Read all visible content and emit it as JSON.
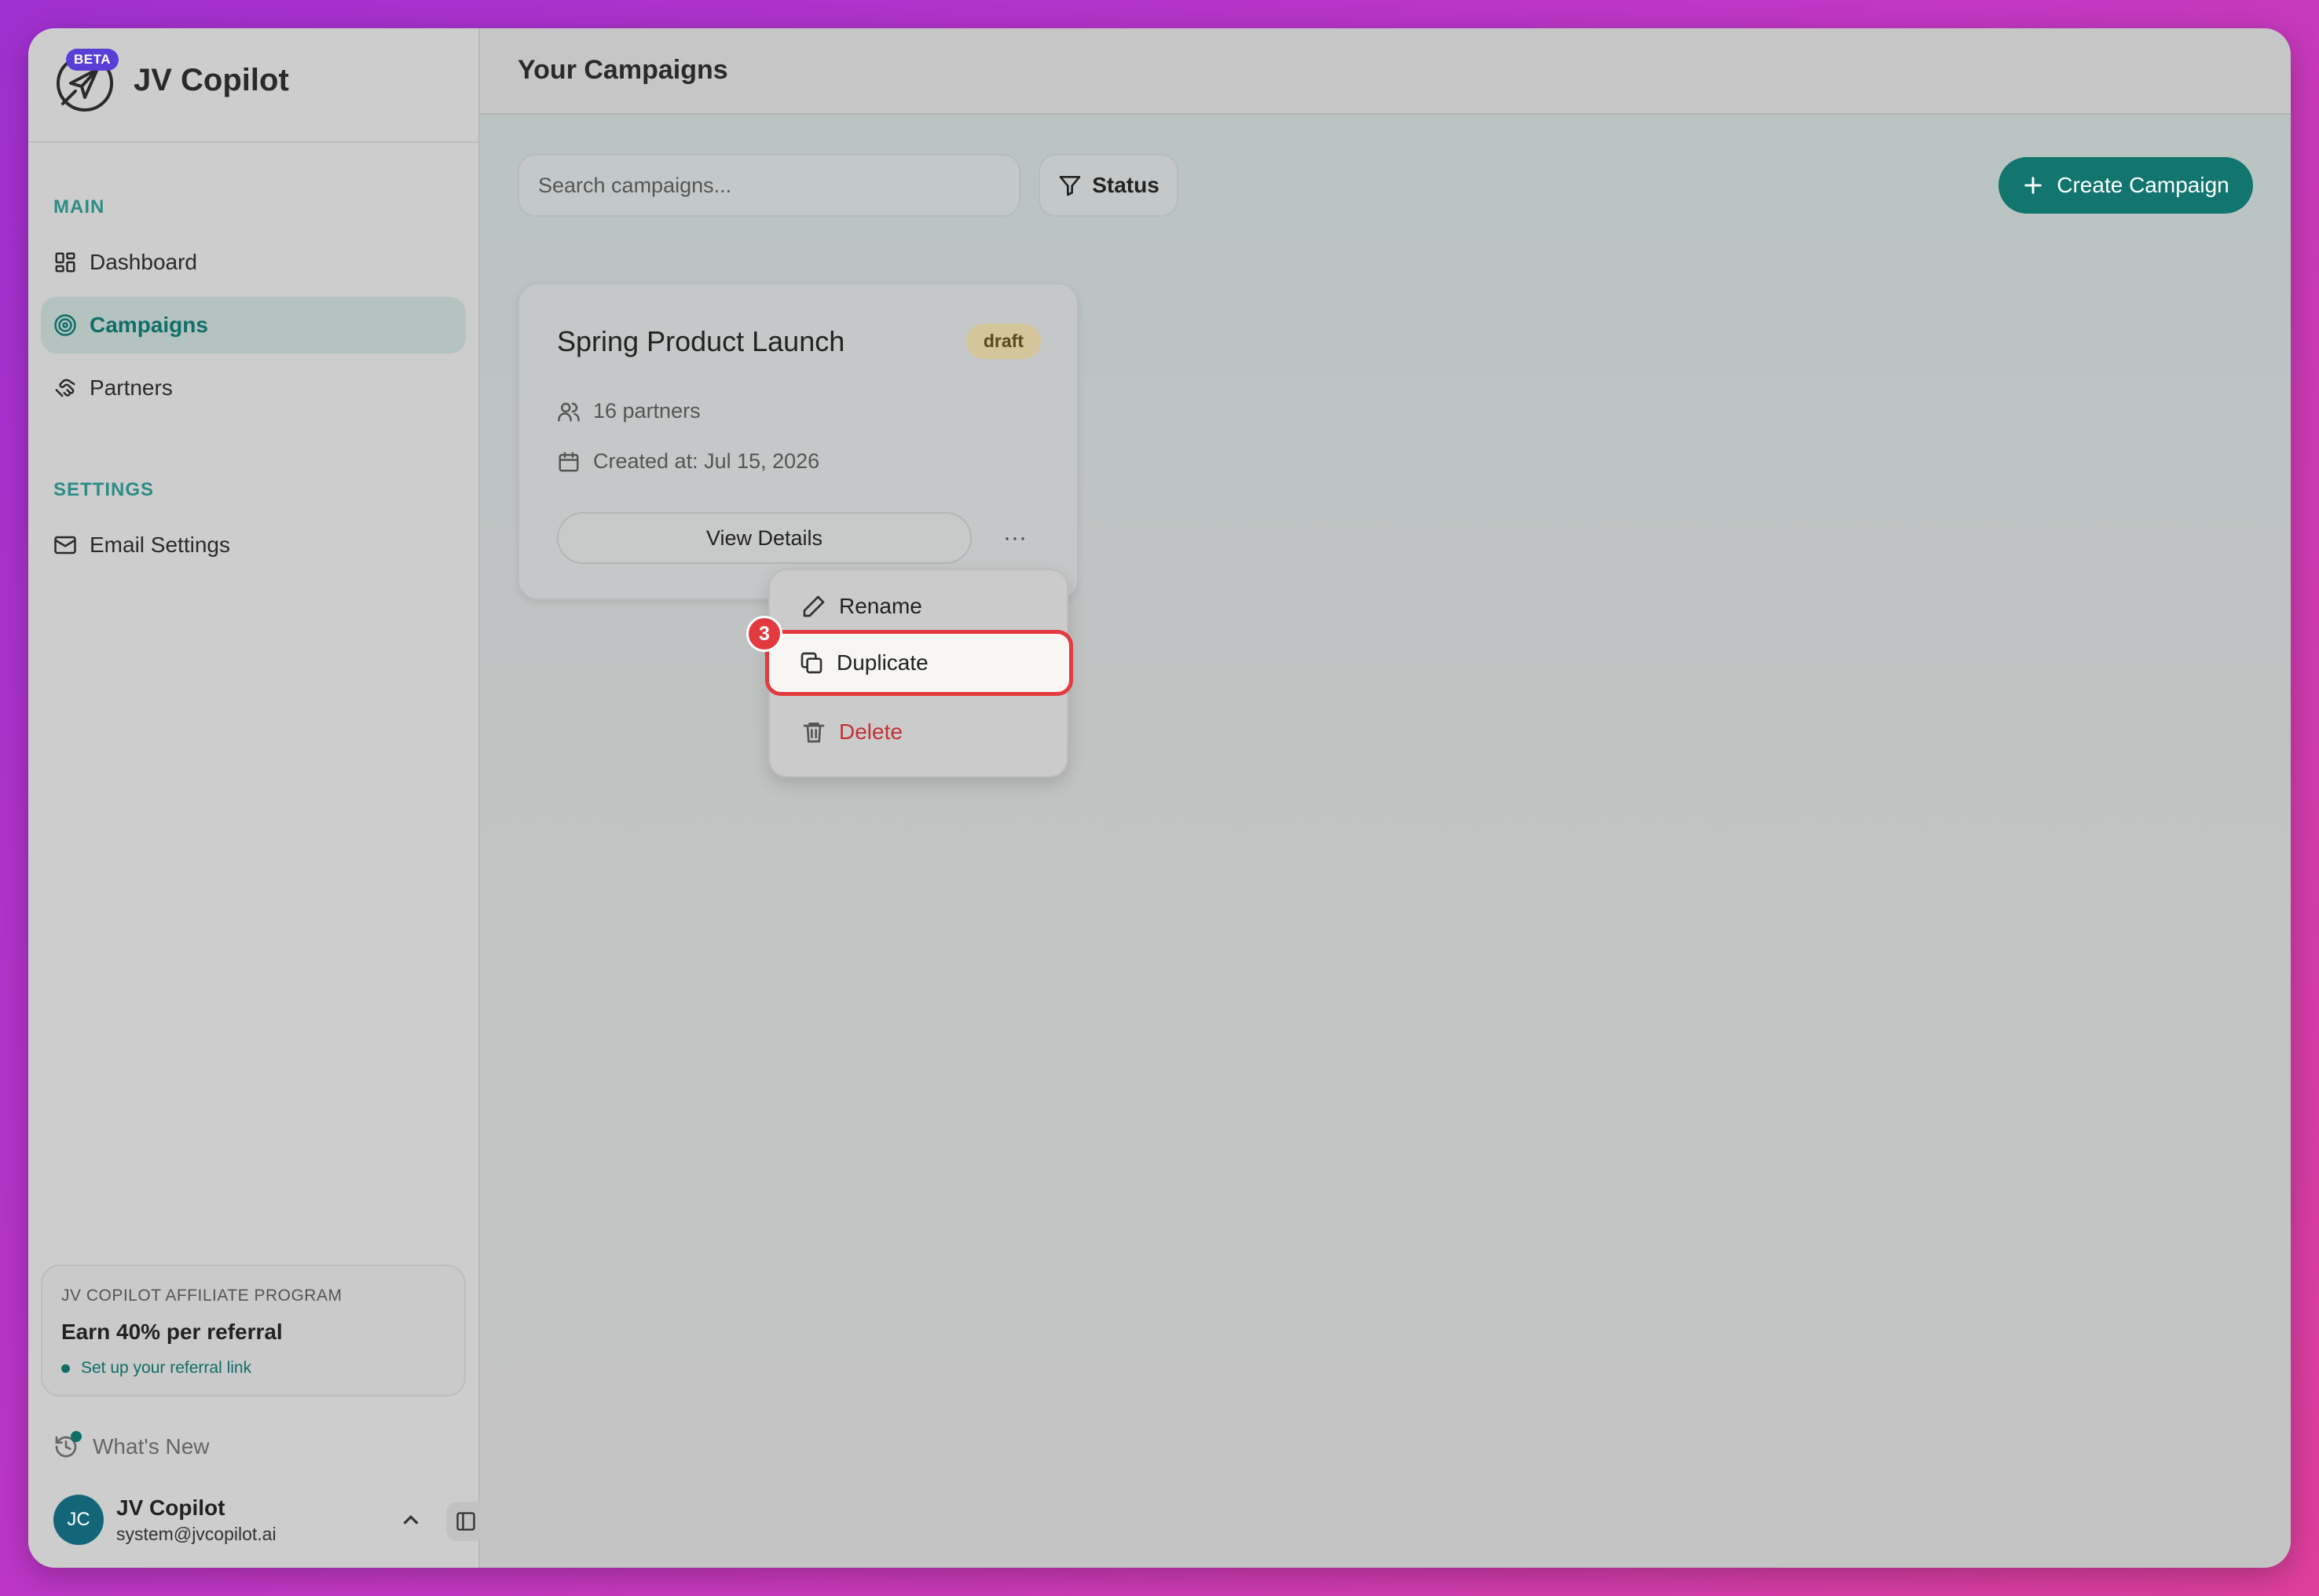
{
  "brand": {
    "name": "JV Copilot",
    "beta": "BETA"
  },
  "sidebar": {
    "main_label": "MAIN",
    "items": [
      {
        "label": "Dashboard",
        "icon": "dashboard-icon"
      },
      {
        "label": "Campaigns",
        "icon": "target-icon",
        "active": true
      },
      {
        "label": "Partners",
        "icon": "handshake-icon"
      }
    ],
    "settings_label": "SETTINGS",
    "settings_items": [
      {
        "label": "Email Settings",
        "icon": "mail-icon"
      }
    ],
    "affiliate": {
      "title": "JV COPILOT AFFILIATE PROGRAM",
      "headline": "Earn 40% per referral",
      "link": "Set up your referral link"
    },
    "whats_new": "What's New",
    "user": {
      "initials": "JC",
      "name": "JV Copilot",
      "email": "system@jvcopilot.ai"
    }
  },
  "main": {
    "title": "Your Campaigns",
    "search_placeholder": "Search campaigns...",
    "status_label": "Status",
    "create_label": "Create Campaign",
    "campaign": {
      "title": "Spring Product Launch",
      "status": "draft",
      "partners": "16 partners",
      "created": "Created at: Jul 15, 2026",
      "details_label": "View Details",
      "more_label": "···"
    },
    "menu": {
      "rename": "Rename",
      "duplicate": "Duplicate",
      "delete": "Delete",
      "step": "3"
    }
  },
  "colors": {
    "accent": "#12756e",
    "highlight": "#e23a3e",
    "danger": "#c23232",
    "beta": "#5a3fd6"
  }
}
